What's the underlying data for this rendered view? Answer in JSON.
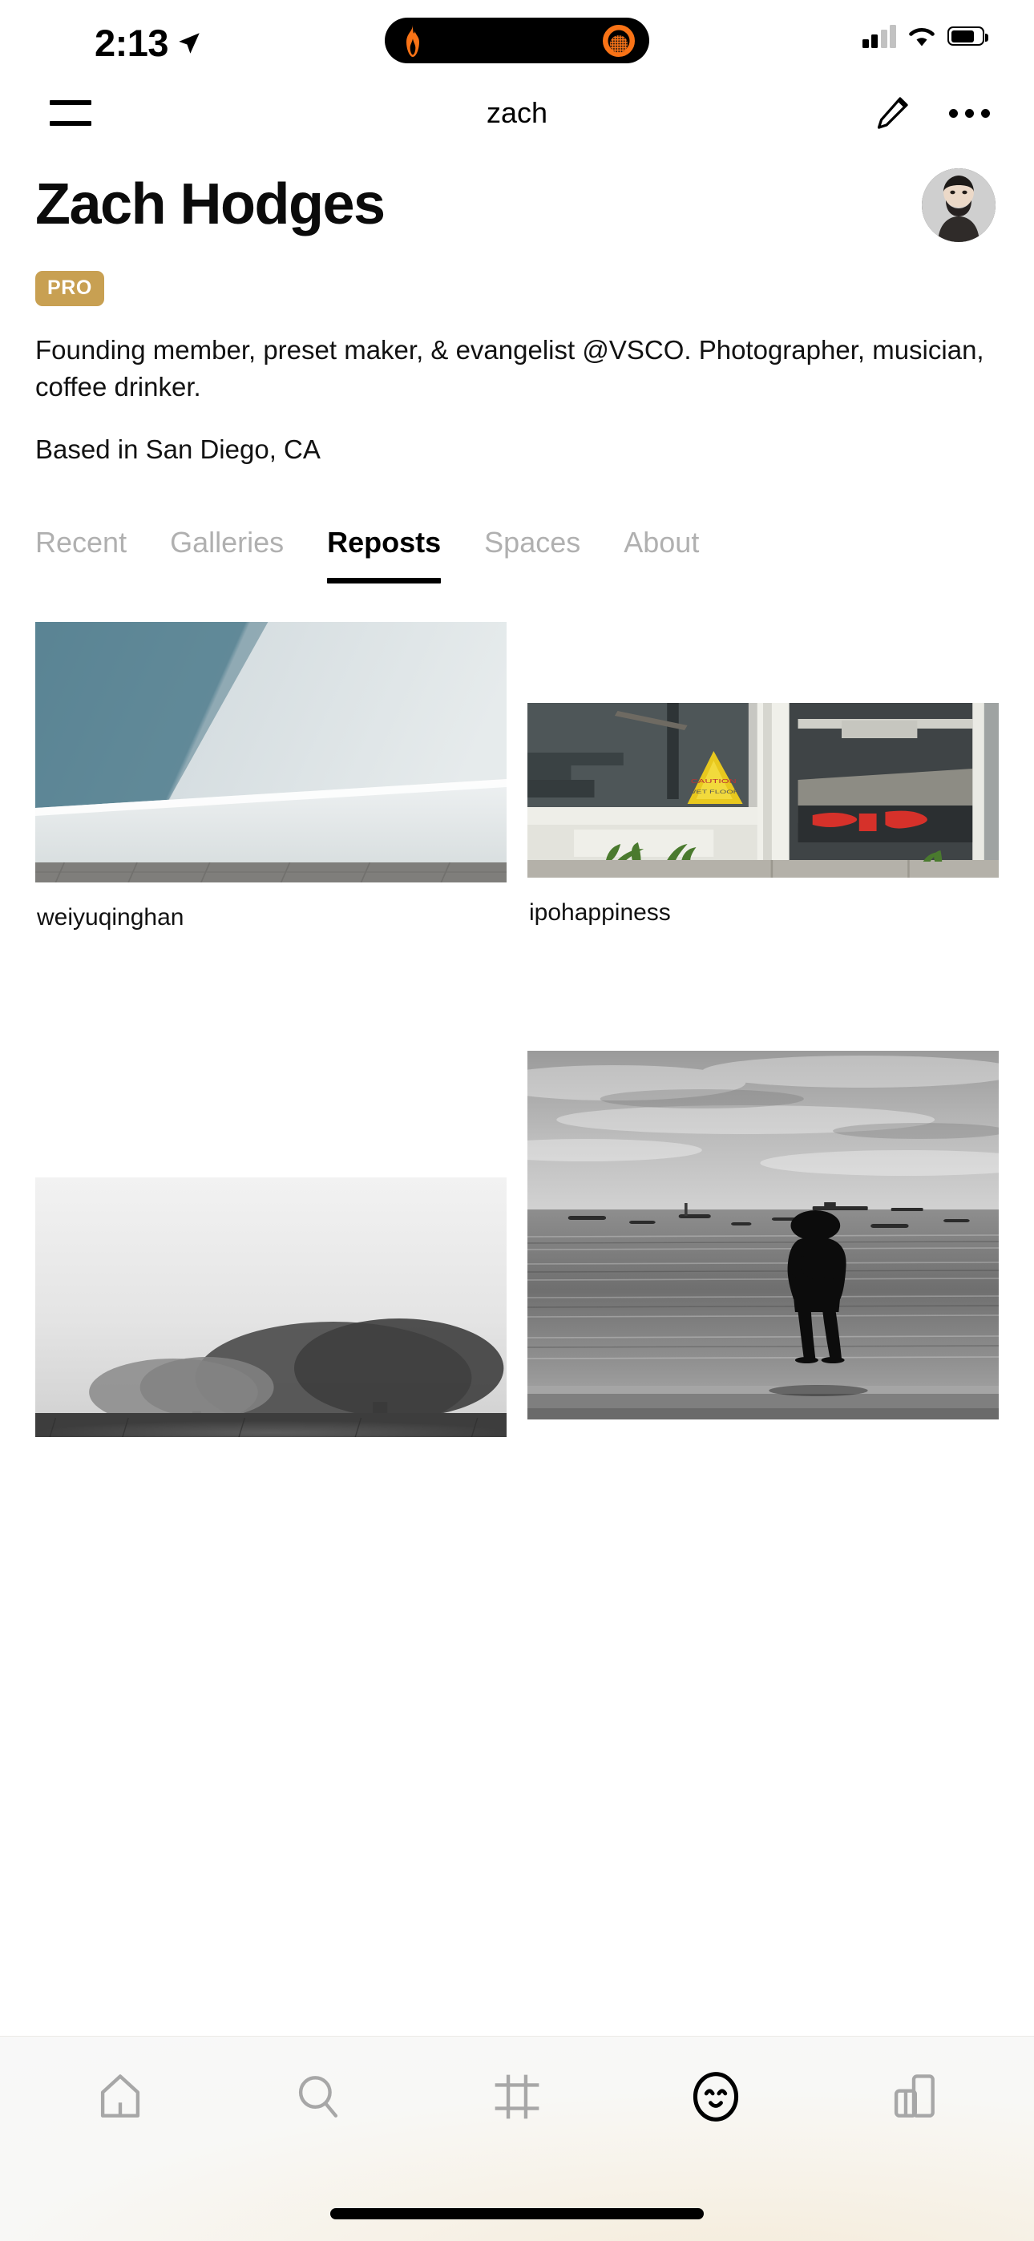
{
  "status_bar": {
    "time": "2:13",
    "location_arrow_icon": "location-arrow-icon",
    "dynamic_island": {
      "left_icon": "flame-icon",
      "right_icon": "orange-ring-icon",
      "flame_color": "#F97316",
      "ring_color": "#F97316",
      "background": "#000000"
    },
    "cellular_icon": "cellular-signal-icon",
    "wifi_icon": "wifi-icon",
    "battery_icon": "battery-icon"
  },
  "nav_bar": {
    "menu_icon": "hamburger-menu-icon",
    "title": "zach",
    "edit_icon": "pencil-edit-icon",
    "more_icon": "more-options-icon"
  },
  "profile": {
    "display_name": "Zach Hodges",
    "avatar_icon": "user-avatar-photo",
    "badge": {
      "label": "PRO",
      "background_color": "#C8A052",
      "text_color": "#FFFFFF"
    },
    "bio": "Founding member, preset maker, & evangelist @VSCO. Photographer, musician, coffee drinker.",
    "location": "Based in San Diego, CA"
  },
  "tabs": {
    "active": "Reposts",
    "items": [
      {
        "label": "Recent",
        "active": false
      },
      {
        "label": "Galleries",
        "active": false
      },
      {
        "label": "Reposts",
        "active": true
      },
      {
        "label": "Spaces",
        "active": false
      },
      {
        "label": "About",
        "active": false
      }
    ]
  },
  "grid": {
    "left_column": [
      {
        "caption": "weiyuqinghan",
        "alt": "teal blue wall with diagonal shadow and white ledge above brick pavement"
      },
      {
        "caption": "",
        "alt": "black and white foggy field with two trees in mist"
      }
    ],
    "right_column": [
      {
        "caption": "ipohappiness",
        "alt": "storefront glass doors with yellow caution wet floor sign, red lettering decal and weeds at base"
      },
      {
        "caption": "",
        "alt": "black and white seaside scene, silhouette of a person standing at the shoreline with boats on the water"
      }
    ]
  },
  "bottom_tab_bar": {
    "items": [
      {
        "icon": "home-icon",
        "label": "Home",
        "active": false
      },
      {
        "icon": "search-icon",
        "label": "Discover",
        "active": false
      },
      {
        "icon": "studio-crop-icon",
        "label": "Studio",
        "active": false
      },
      {
        "icon": "smiley-profile-icon",
        "label": "Profile",
        "active": true
      },
      {
        "icon": "spaces-icon",
        "label": "Spaces",
        "active": false
      }
    ],
    "home_indicator": "home-indicator-bar"
  }
}
